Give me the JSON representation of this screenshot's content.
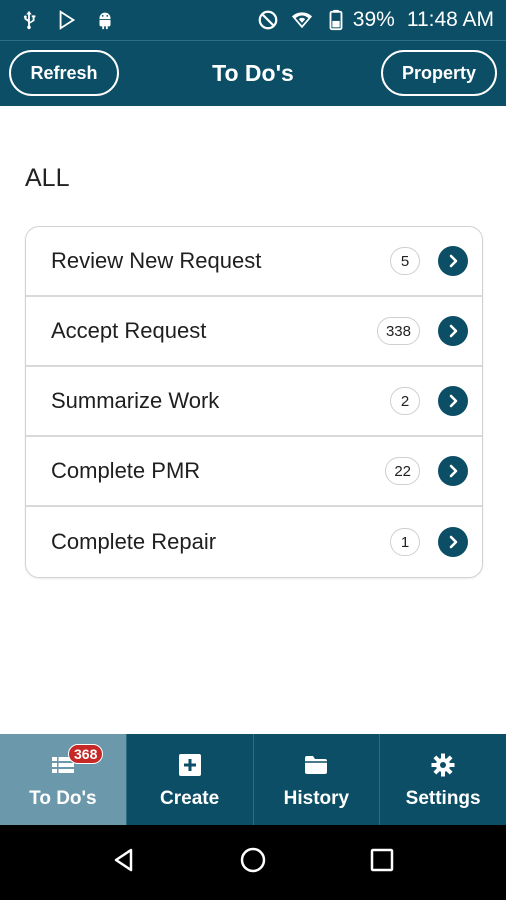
{
  "status_bar": {
    "battery": "39%",
    "time": "11:48 AM",
    "icons": [
      "usb-icon",
      "play-store-icon",
      "android-icon",
      "do-not-disturb-icon",
      "wifi-icon",
      "battery-icon"
    ]
  },
  "header": {
    "title": "To Do's",
    "left_button": "Refresh",
    "right_button": "Property"
  },
  "section": {
    "title": "ALL"
  },
  "todos": [
    {
      "label": "Review New Request",
      "count": "5"
    },
    {
      "label": "Accept Request",
      "count": "338"
    },
    {
      "label": "Summarize Work",
      "count": "2"
    },
    {
      "label": "Complete PMR",
      "count": "22"
    },
    {
      "label": "Complete Repair",
      "count": "1"
    }
  ],
  "bottom_nav": {
    "items": [
      {
        "label": "To Do's",
        "icon": "list-icon",
        "badge": "368",
        "active": true
      },
      {
        "label": "Create",
        "icon": "plus-box-icon"
      },
      {
        "label": "History",
        "icon": "folder-icon"
      },
      {
        "label": "Settings",
        "icon": "gear-icon"
      }
    ]
  },
  "colors": {
    "primary": "#0b4e66",
    "active_tab": "#6c98ab",
    "badge": "#c62828"
  }
}
